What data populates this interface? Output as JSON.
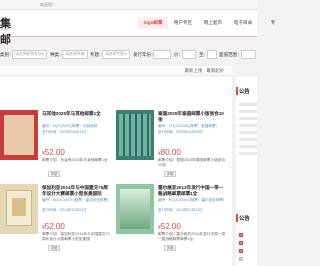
{
  "topbar": {
    "welcome": "欢迎您！"
  },
  "logo": {
    "mark": "集邮",
    "sub": "JIYOU"
  },
  "nav": {
    "items": [
      {
        "label": "Sign邮票",
        "active": true
      },
      {
        "label": "用户专区",
        "active": false
      },
      {
        "label": "网上超市",
        "active": false
      },
      {
        "label": "电子目录",
        "active": false
      },
      {
        "label": "专",
        "active": false
      }
    ]
  },
  "filter": {
    "category": {
      "label": "类别：",
      "placeholder": "请选择邮票类别"
    },
    "kind": {
      "label": "种类：",
      "placeholder": "请选择种类"
    },
    "topic": {
      "label": "专题：",
      "placeholder": "请选择专题"
    },
    "year": {
      "label": "发行年份：",
      "placeholder": ""
    },
    "min": {
      "label": "价：",
      "placeholder": ""
    },
    "to": {
      "label": "至：",
      "placeholder": ""
    },
    "ref": {
      "label": "面值范围：",
      "placeholder": ""
    }
  },
  "sort": {
    "links": [
      "最新上线",
      "最新起价"
    ]
  },
  "products": [
    {
      "title": "马耳他2025年马耳他邮票1全",
      "code": "编号：M(JT)0025 [邮票：马耳他邮",
      "date": "发行时间：2025年05月13日",
      "price_symbol": "¥",
      "price": "52.00",
      "desc": "邮票介绍：马耳他2025年马耳他邮票1全",
      "button": "详细",
      "thumb": "thumb-a"
    },
    {
      "title": "泰国2025年泰国邮票小版张合10张",
      "code": "编号：TH(JC)0028 [邮票：泰国邮票]",
      "date": "发行时间：2025年04月09日",
      "price_symbol": "¥",
      "price": "80.00",
      "desc": "邮票介绍：泰国2025年泰国邮票小版张合10张",
      "button": "详细",
      "thumb": "thumb-b"
    },
    {
      "title": "保加利亚2014年与中国建交75周年设计大赛邮票小型张奥国际",
      "code": "编号：BG(JC)0079 [邮票：保加利亚邮票]",
      "date": "发行时间：2014年12月24日",
      "price_symbol": "¥",
      "price": "52.00",
      "desc": "邮票介绍：保加利亚2014年与中国建交75周年设计大赛邮票小型张奥国",
      "button": "详细",
      "thumb": "thumb-c"
    },
    {
      "title": "塞尔维亚2013年发行中国一带一路战略邮票邮票1全",
      "code": "编号：RS(JC)0055 [邮票：塞尔维亚邮票]",
      "date": "发行时间：2013年03月21日",
      "price_symbol": "¥",
      "price": "52.00",
      "desc": "邮票介绍：塞尔维亚2013年发行中国一带一路战略邮票邮票1全",
      "button": "详细",
      "thumb": "thumb-d"
    }
  ],
  "side": {
    "title1": "公告",
    "title2": "公告",
    "nums": [
      "1",
      "2",
      "3",
      "4"
    ]
  },
  "colors": {
    "accent": "#d04b4b",
    "link": "#5a8fc9"
  }
}
